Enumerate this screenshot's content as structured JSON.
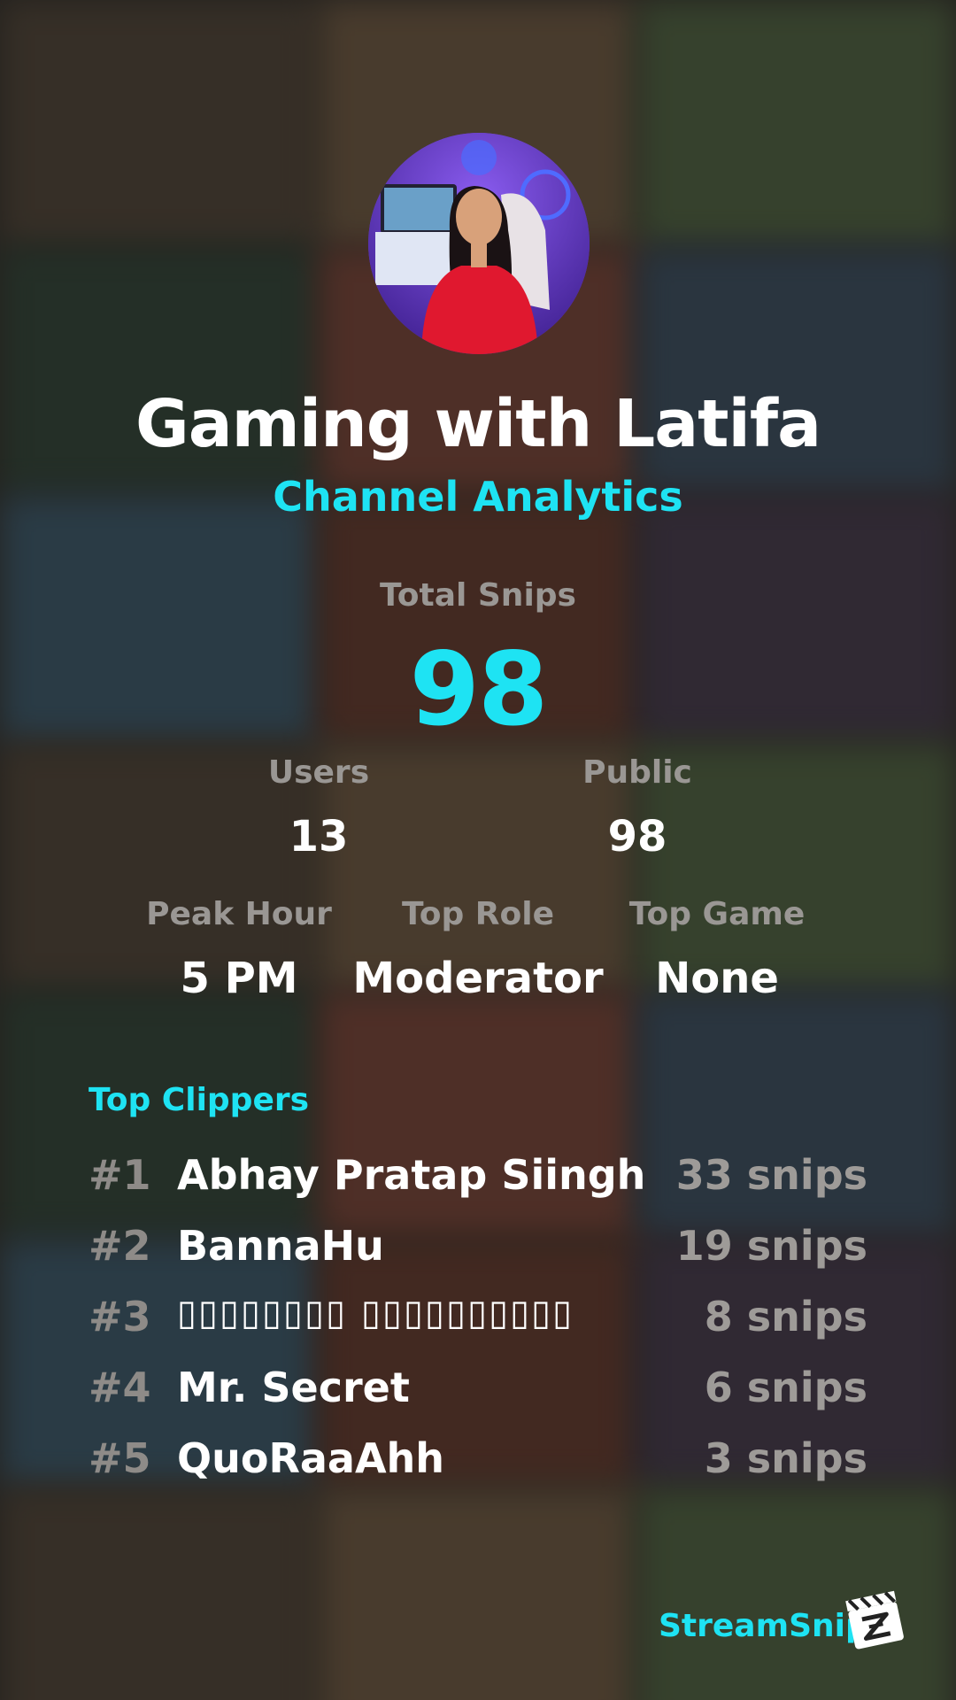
{
  "colors": {
    "accent": "#1ee3f3",
    "muted": "#9a9794"
  },
  "channel": {
    "name": "Gaming with Latifa",
    "subtitle": "Channel Analytics"
  },
  "totals": {
    "label": "Total Snips",
    "value": "98"
  },
  "stats_row1": [
    {
      "label": "Users",
      "value": "13"
    },
    {
      "label": "Public",
      "value": "98"
    }
  ],
  "stats_row2": [
    {
      "label": "Peak Hour",
      "value": "5 PM"
    },
    {
      "label": "Top Role",
      "value": "Moderator"
    },
    {
      "label": "Top Game",
      "value": "None"
    }
  ],
  "top_clippers": {
    "heading": "Top Clippers",
    "items": [
      {
        "rank": "#1",
        "name": "Abhay Pratap Siingh",
        "count": "33 snips"
      },
      {
        "rank": "#2",
        "name": "BannaHu",
        "count": "19 snips"
      },
      {
        "rank": "#3",
        "name": "▯▯▯▯▯▯▯▯ ▯▯▯▯▯▯▯▯▯▯",
        "count": "8 snips"
      },
      {
        "rank": "#4",
        "name": "Mr. Secret",
        "count": "6 snips"
      },
      {
        "rank": "#5",
        "name": "QuoRaaAhh",
        "count": "3 snips"
      }
    ]
  },
  "brand": {
    "name": "StreamSnip",
    "logo_icon": "clapperboard-icon"
  },
  "avatar": {
    "icon": "channel-avatar"
  }
}
